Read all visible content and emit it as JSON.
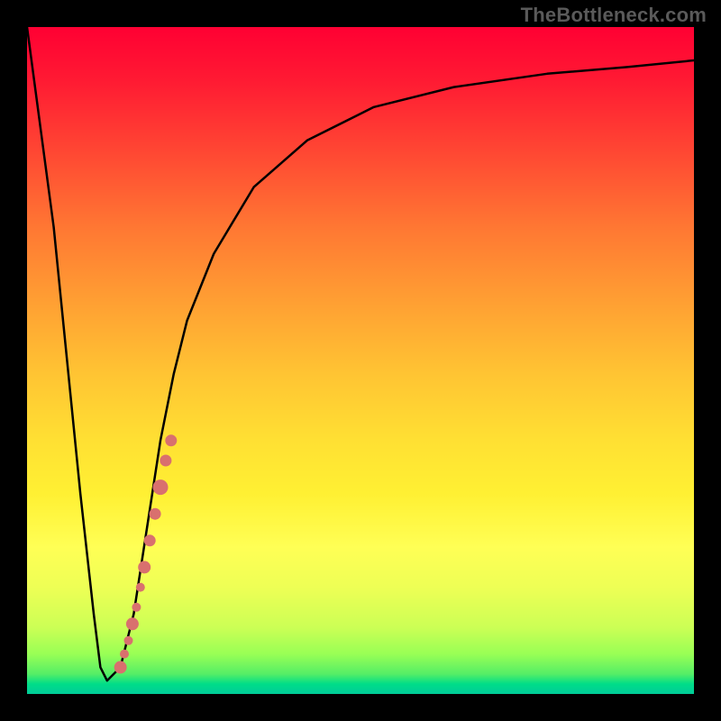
{
  "watermark": "TheBottleneck.com",
  "chart_data": {
    "type": "line",
    "title": "",
    "xlabel": "",
    "ylabel": "",
    "xlim": [
      0,
      100
    ],
    "ylim": [
      0,
      100
    ],
    "grid": false,
    "series": [
      {
        "name": "bottleneck-curve",
        "x": [
          0,
          4,
          8,
          10,
          11,
          12,
          14,
          16,
          18,
          20,
          22,
          24,
          28,
          34,
          42,
          52,
          64,
          78,
          90,
          100
        ],
        "y": [
          100,
          70,
          30,
          12,
          4,
          2,
          4,
          12,
          25,
          38,
          48,
          56,
          66,
          76,
          83,
          88,
          91,
          93,
          94,
          95
        ]
      }
    ],
    "markers": {
      "name": "highlight-dots",
      "color": "#d9706e",
      "points": [
        {
          "x": 14.0,
          "y": 4.0
        },
        {
          "x": 14.6,
          "y": 6.0
        },
        {
          "x": 15.2,
          "y": 8.0
        },
        {
          "x": 15.8,
          "y": 10.5
        },
        {
          "x": 16.4,
          "y": 13.0
        },
        {
          "x": 17.0,
          "y": 16.0
        },
        {
          "x": 17.6,
          "y": 19.0
        },
        {
          "x": 18.4,
          "y": 23.0
        },
        {
          "x": 19.2,
          "y": 27.0
        },
        {
          "x": 20.0,
          "y": 31.0
        },
        {
          "x": 20.8,
          "y": 35.0
        },
        {
          "x": 21.6,
          "y": 38.0
        }
      ]
    },
    "background_gradient": {
      "top": "#ff0033",
      "mid": "#ffff55",
      "bottom": "#00cc99"
    }
  }
}
